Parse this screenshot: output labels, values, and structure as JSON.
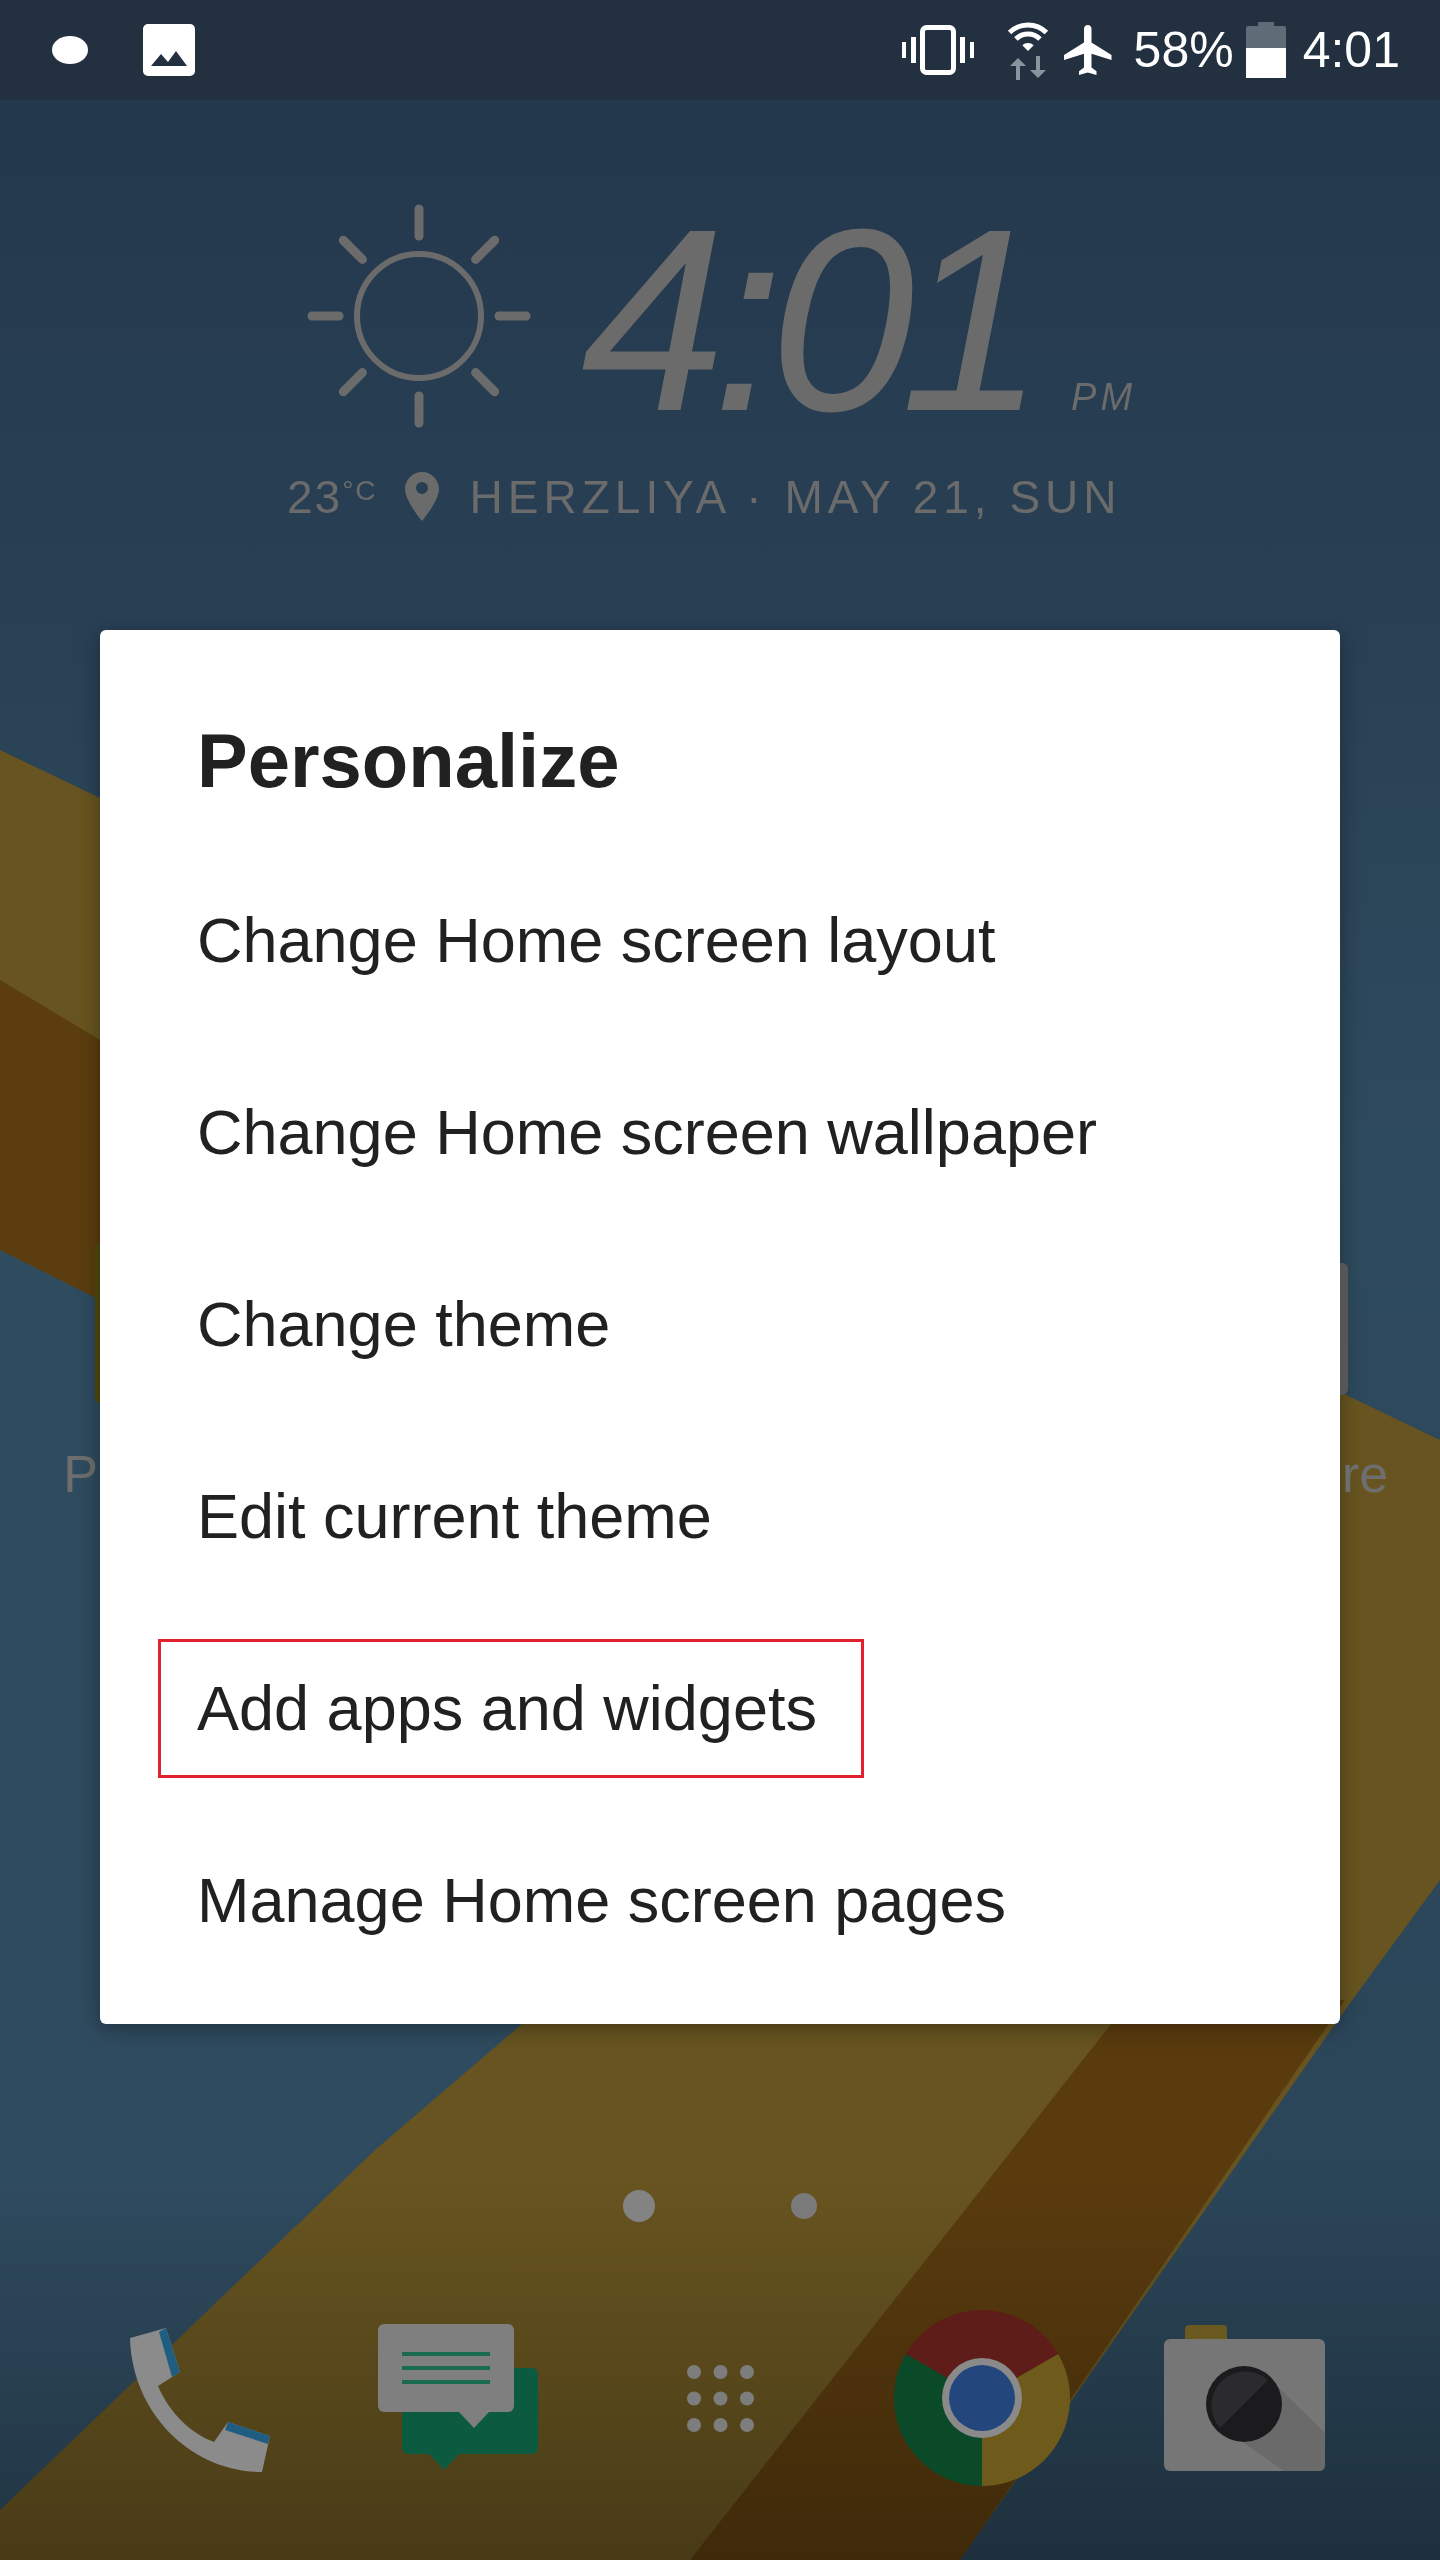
{
  "status_bar": {
    "battery": "58%",
    "time": "4:01"
  },
  "clock_widget": {
    "time": "4:01",
    "period": "PM",
    "temperature": "23$^{°C}$",
    "location_date": "HERZLIYA · MAY 21, SUN"
  },
  "covered_app_labels": [
    {
      "label": "P"
    },
    {
      "label": "re"
    }
  ],
  "dialog": {
    "title": "Personalize",
    "items": [
      {
        "label": "Change Home screen layout",
        "highlighted": false
      },
      {
        "label": "Change Home screen wallpaper",
        "highlighted": false
      },
      {
        "label": "Change theme",
        "highlighted": false
      },
      {
        "label": "Edit current theme",
        "highlighted": false
      },
      {
        "label": "Add apps and widgets",
        "highlighted": true
      },
      {
        "label": "Manage Home screen pages",
        "highlighted": false
      }
    ]
  },
  "page_indicator": [
    {
      "selected": true
    },
    {
      "selected": false
    }
  ]
}
